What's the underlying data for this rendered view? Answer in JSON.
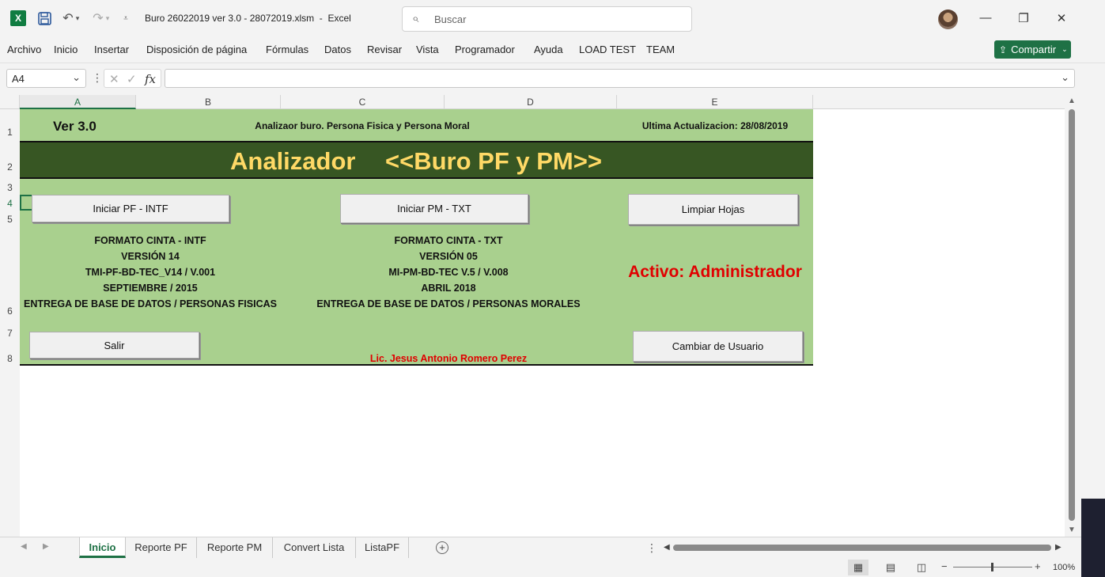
{
  "window": {
    "title": "Buro 26022019 ver 3.0 - 28072019.xlsm  -  Excel",
    "search_placeholder": "Buscar",
    "share_label": "Compartir"
  },
  "menu": [
    "Archivo",
    "Inicio",
    "Insertar",
    "Disposición de página",
    "Fórmulas",
    "Datos",
    "Revisar",
    "Vista",
    "Programador",
    "Ayuda",
    "LOAD TEST",
    "TEAM"
  ],
  "formula_bar": {
    "name_box": "A4",
    "fx": "fx",
    "value": ""
  },
  "columns": [
    "A",
    "B",
    "C",
    "D",
    "E"
  ],
  "rows": [
    "1",
    "2",
    "3",
    "4",
    "5",
    "6",
    "7",
    "8"
  ],
  "sheet": {
    "version": "Ver 3.0",
    "subtitle": "Analizaor buro. Persona Fisica y Persona Moral",
    "last_update": "Ultima Actualizacion: 28/08/2019",
    "title_left": "Analizador",
    "title_right": "<<Buro PF y PM>>",
    "btn_pf": "Iniciar PF - INTF",
    "btn_pm": "Iniciar PM - TXT",
    "btn_clear": "Limpiar Hojas",
    "pf_info": [
      "FORMATO CINTA - INTF",
      "VERSIÓN 14",
      "TMI-PF-BD-TEC_V14 / V.001",
      "SEPTIEMBRE / 2015",
      "ENTREGA DE BASE DE DATOS / PERSONAS FISICAS"
    ],
    "pm_info": [
      "FORMATO CINTA - TXT",
      "VERSIÓN 05",
      "MI-PM-BD-TEC V.5 / V.008",
      "ABRIL 2018",
      "ENTREGA DE BASE DE DATOS / PERSONAS MORALES"
    ],
    "active_user": "Activo: Administrador",
    "btn_exit": "Salir",
    "btn_change_user": "Cambiar de Usuario",
    "author": "Lic. Jesus Antonio Romero Perez"
  },
  "tabs": [
    "Inicio",
    "Reporte PF",
    "Reporte PM",
    "Convert Lista",
    "ListaPF"
  ],
  "status": {
    "zoom": "100%"
  },
  "colors": {
    "sheet_green": "#a9d08e",
    "dark_green": "#375623",
    "title_gold": "#ffd966",
    "active_red": "#e00000",
    "excel_green": "#1e7145"
  }
}
